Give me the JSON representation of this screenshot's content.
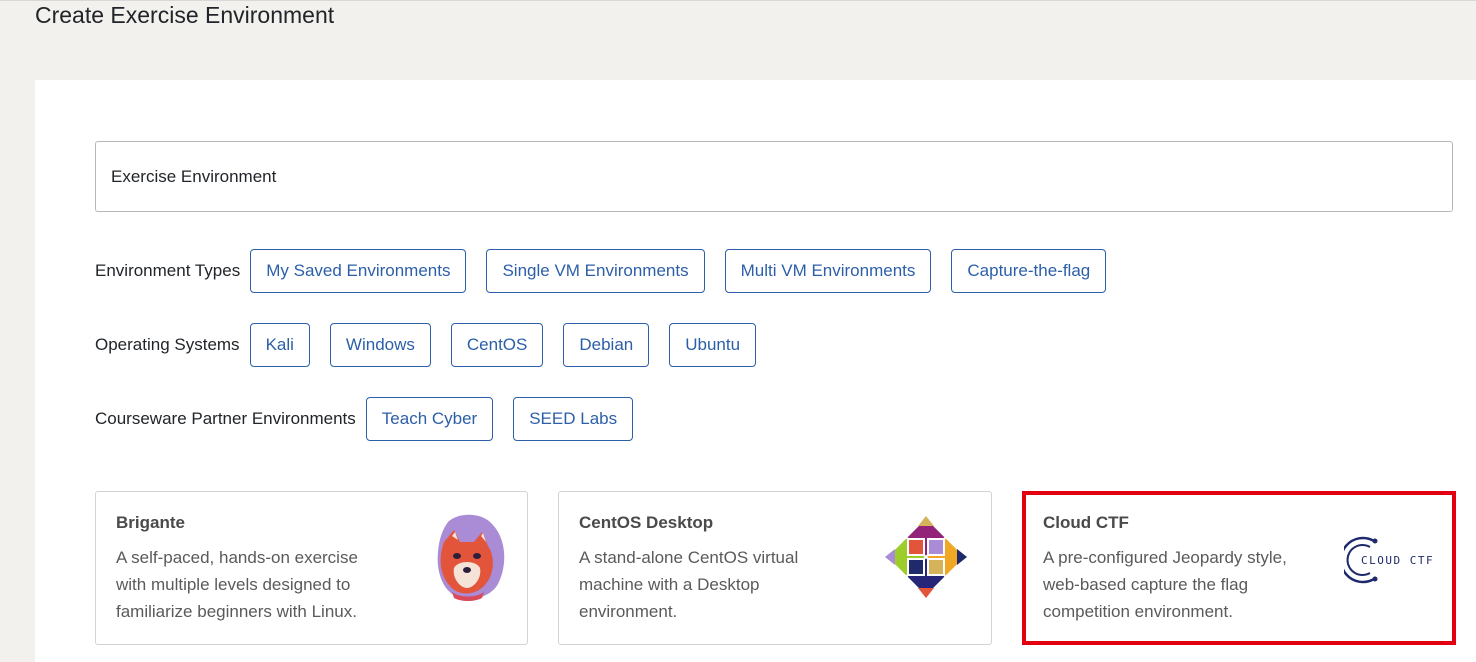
{
  "page": {
    "title": "Create Exercise Environment"
  },
  "search": {
    "value": "Exercise Environment"
  },
  "filters": {
    "environment_types": {
      "label": "Environment Types",
      "options": [
        "My Saved Environments",
        "Single VM Environments",
        "Multi VM Environments",
        "Capture-the-flag"
      ]
    },
    "operating_systems": {
      "label": "Operating Systems",
      "options": [
        "Kali",
        "Windows",
        "CentOS",
        "Debian",
        "Ubuntu"
      ]
    },
    "courseware_partners": {
      "label": "Courseware Partner Environments",
      "options": [
        "Teach Cyber",
        "SEED Labs"
      ]
    }
  },
  "cards": [
    {
      "title": "Brigante",
      "description": "A self-paced, hands-on exercise with multiple levels designed to familiarize beginners with Linux.",
      "icon": "fox-mascot-icon"
    },
    {
      "title": "CentOS Desktop",
      "description": "A stand-alone CentOS virtual machine with a Desktop environment.",
      "icon": "centos-logo-icon"
    },
    {
      "title": "Cloud CTF",
      "description": "A pre-configured Jeopardy style, web-based capture the flag competition environment.",
      "icon": "cloud-ctf-logo-icon",
      "logo_text": "CLOUD CTF",
      "selected": true
    }
  ],
  "colors": {
    "accent": "#2c5fa8",
    "selection": "#e3000f",
    "background": "#f2f1ed"
  }
}
